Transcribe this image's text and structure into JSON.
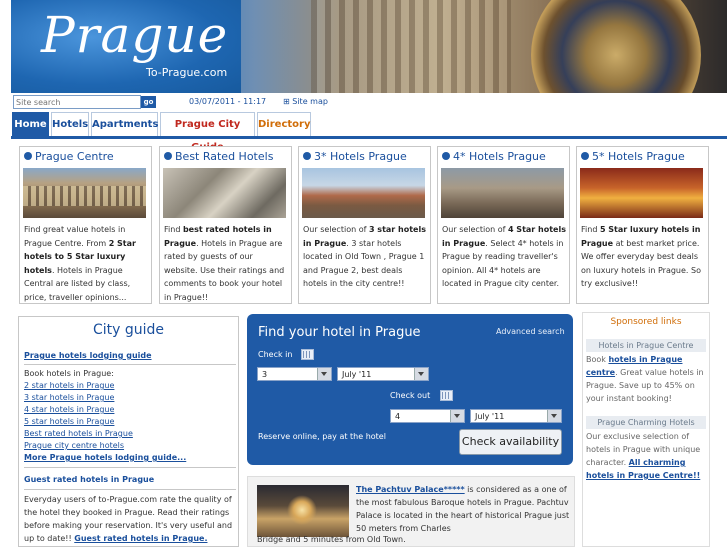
{
  "header": {
    "logo": "Prague",
    "logo_sub": "To-Prague.com"
  },
  "search": {
    "placeholder": "Site search",
    "go_label": "go",
    "datetime": "03/07/2011 - 11:17",
    "sitemap": "Site map"
  },
  "nav": {
    "tabs": [
      {
        "label": "Home"
      },
      {
        "label": "Hotels"
      },
      {
        "label": "Apartments"
      },
      {
        "label": "Prague City Guide"
      },
      {
        "label": "Directory"
      }
    ]
  },
  "categories": [
    {
      "title": "Prague Centre",
      "t1": "Find great value hotels in Prague Centre. From ",
      "b1": "2 Star hotels to 5 Star luxury hotels",
      "t2": ". Hotels in Prague Central are listed by class, price, traveller opinions..."
    },
    {
      "title": "Best Rated Hotels",
      "t1": "Find ",
      "b1": "best rated hotels in Prague",
      "t2": ". Hotels in Prague are rated by guests of our website. Use their ratings and comments to book your hotel in Prague!!"
    },
    {
      "title": "3* Hotels Prague",
      "t1": "Our selection of ",
      "b1": "3 star hotels in Prague",
      "t2": ". 3 star hotels located in Old Town , Prague 1 and Prague 2, best deals hotels in the city centre!!"
    },
    {
      "title": "4* Hotels Prague",
      "t1": "Our selection of ",
      "b1": "4 Star hotels in Prague",
      "t2": ". Select 4* hotels in Prague by reading traveller's opinion. All 4* hotels are located in Prague city center."
    },
    {
      "title": "5* Hotels Prague",
      "t1": "Find ",
      "b1": "5 Star luxury hotels in Prague",
      "t2": " at best market price. We offer everyday best deals on luxury hotels in Prague. So try exclusive!!"
    }
  ],
  "city_guide": {
    "title": "City guide",
    "section1": "Prague hotels lodging guide",
    "book_text": "Book hotels in Prague:",
    "links": [
      "2 star hotels in Prague",
      "3 star hotels in Prague",
      "4 star hotels in Prague",
      "5 star hotels in Prague",
      "Best rated hotels in Prague",
      "Prague city centre hotels"
    ],
    "more_link": "More Prague hotels lodging guide...",
    "section2": "Guest rated hotels in Prague",
    "text2a": "Everyday users of to-Prague.com rate the quality of the hotel they booked in Prague. Read their ratings before making your reservation. It's very useful and up to date!!",
    "text2_link": "Guest rated hotels in Prague."
  },
  "finder": {
    "title": "Find your hotel in Prague",
    "advanced": "Advanced search",
    "checkin_label": "Check in",
    "checkin_day": "3",
    "checkin_month": "July '11",
    "checkout_label": "Check out",
    "checkout_day": "4",
    "checkout_month": "July '11",
    "reserve": "Reserve online, pay at the hotel",
    "button": "Check availability"
  },
  "promo": {
    "link": "The Pachtuv Palace*****",
    "text1": " is considered as a one of the most fabulous Baroque hotels in Prague. Pachtuv Palace is located in the heart of historical Prague just 50 meters from Charles",
    "text2": "Bridge and 5 minutes from Old Town."
  },
  "sponsored": {
    "title": "Sponsored links",
    "h1": "Hotels in Prague Centre",
    "t1a": "Book ",
    "l1": "hotels in Prague centre",
    "t1b": ". Great value hotels in Prague. Save up to 45% on your instant booking!",
    "h2": "Prague Charming Hotels",
    "t2a": "Our exclusive selection of hotels in Prague with unique character. ",
    "l2": "All charming hotels in Prague Centre!!"
  }
}
